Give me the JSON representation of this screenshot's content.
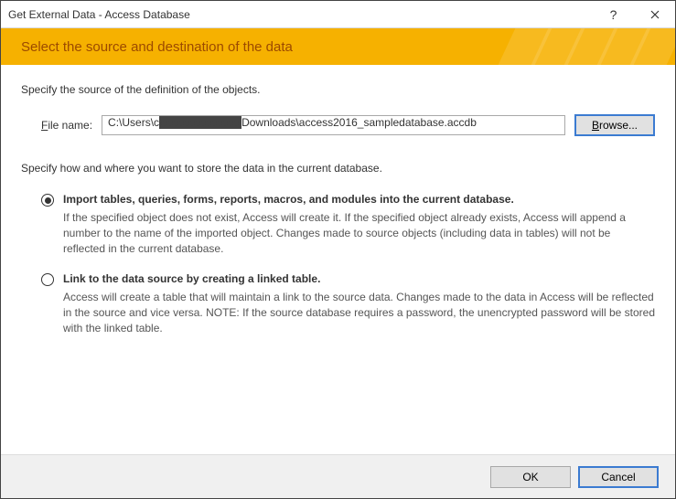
{
  "titlebar": {
    "title": "Get External Data - Access Database"
  },
  "header": {
    "heading": "Select the source and destination of the data"
  },
  "source_section": {
    "label": "Specify the source of the definition of the objects."
  },
  "file": {
    "label_pre": "F",
    "label_post": "ile name:",
    "value_pre": "C:\\Users\\c",
    "value_post": "Downloads\\access2016_sampledatabase.accdb",
    "browse_label_pre": "B",
    "browse_label_post": "rowse..."
  },
  "store_section": {
    "label": "Specify how and where you want to store the data in the current database."
  },
  "options": {
    "import": {
      "title": "Import tables, queries, forms, reports, macros, and modules into the current database.",
      "desc": "If the specified object does not exist, Access will create it. If the specified object already exists, Access will append a number to the name of the imported object. Changes made to source objects (including data in tables) will not be reflected in the current database.",
      "selected": true
    },
    "link": {
      "title": "Link to the data source by creating a linked table.",
      "desc": "Access will create a table that will maintain a link to the source data. Changes made to the data in Access will be reflected in the source and vice versa.  NOTE:  If the source database requires a password, the unencrypted password will be stored with the linked table.",
      "selected": false
    }
  },
  "footer": {
    "ok_label": "OK",
    "cancel_label": "Cancel"
  }
}
